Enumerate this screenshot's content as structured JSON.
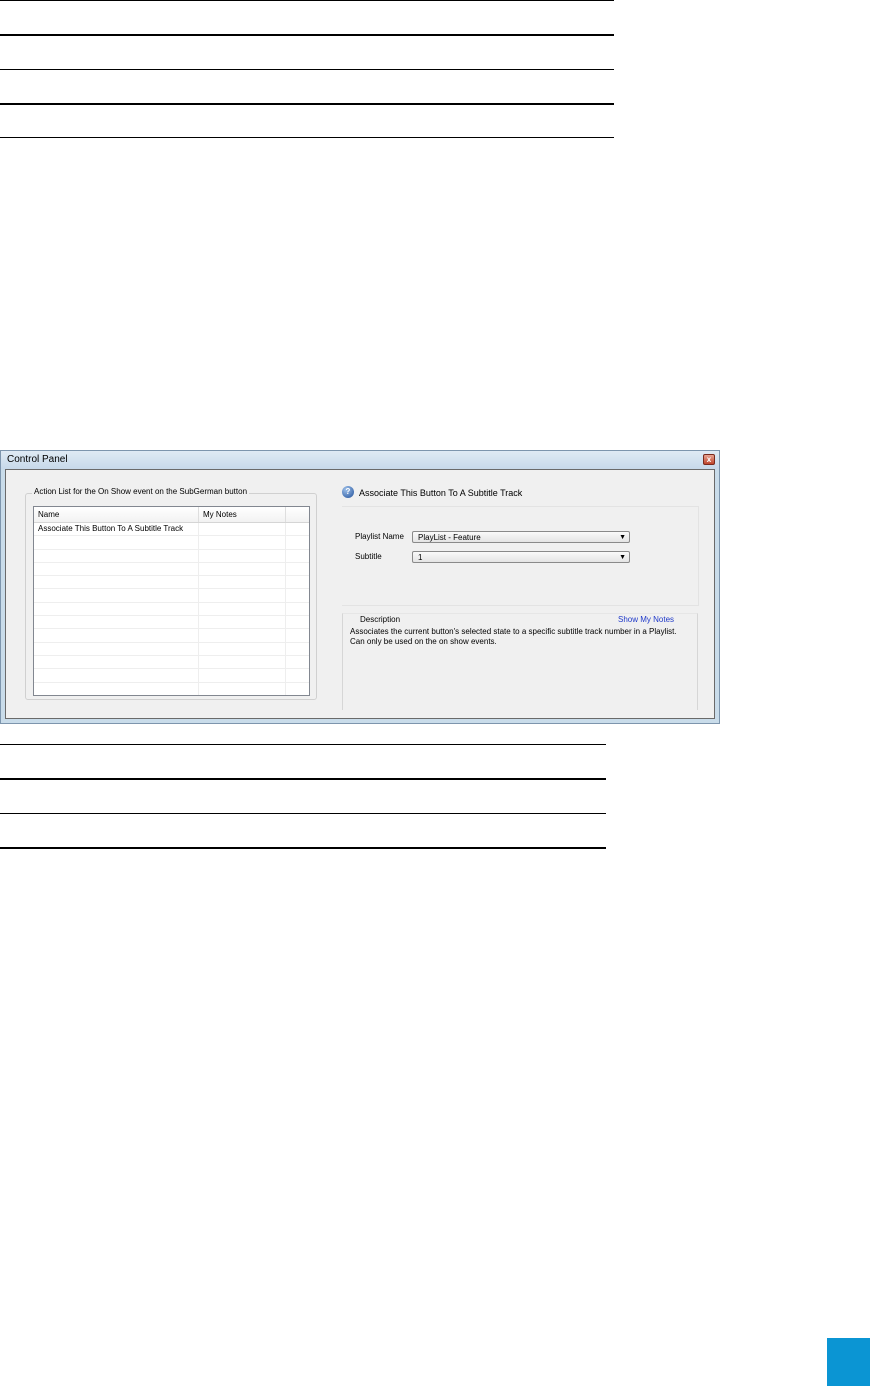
{
  "window": {
    "title": "Control Panel",
    "close_glyph": "x",
    "action_list": {
      "group_label": "Action List for the On Show event on the SubGerman button",
      "columns": [
        "Name",
        "My Notes",
        ""
      ],
      "rows": [
        {
          "name": "Associate This Button To A Subtitle Track",
          "notes": ""
        },
        {
          "name": "",
          "notes": ""
        },
        {
          "name": "",
          "notes": ""
        },
        {
          "name": "",
          "notes": ""
        },
        {
          "name": "",
          "notes": ""
        },
        {
          "name": "",
          "notes": ""
        },
        {
          "name": "",
          "notes": ""
        },
        {
          "name": "",
          "notes": ""
        },
        {
          "name": "",
          "notes": ""
        },
        {
          "name": "",
          "notes": ""
        },
        {
          "name": "",
          "notes": ""
        },
        {
          "name": "",
          "notes": ""
        },
        {
          "name": "",
          "notes": ""
        }
      ]
    },
    "action": {
      "icon": "info-icon",
      "title": "Associate This Button To A Subtitle Track",
      "playlist_label": "Playlist Name",
      "playlist_value": "PlayList - Feature",
      "subtitle_label": "Subtitle",
      "subtitle_value": "1"
    },
    "description": {
      "label": "Description",
      "show_notes_link": "Show My Notes",
      "text": "Associates the current button's selected state to a specific subtitle track number in a Playlist. Can only be used on the on show events."
    }
  },
  "colors": {
    "accent_tab": "#0b95d3",
    "link": "#1f39c9",
    "panel_bg": "#f0f0f0",
    "window_frame": "#c9dcea"
  }
}
